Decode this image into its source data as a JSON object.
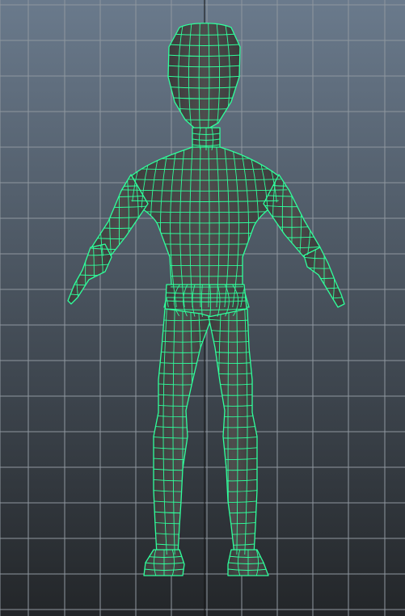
{
  "viewport": {
    "background_top": "#6a7a8c",
    "background_bottom": "#232629",
    "grid_color": "#8f979f",
    "axis_color": "#111111",
    "wire_color": "#2fff9c",
    "mesh_fill": "#3b3b3b",
    "mesh_fill_light": "#4d4d4d",
    "mesh_name": "humanoid-mesh"
  }
}
